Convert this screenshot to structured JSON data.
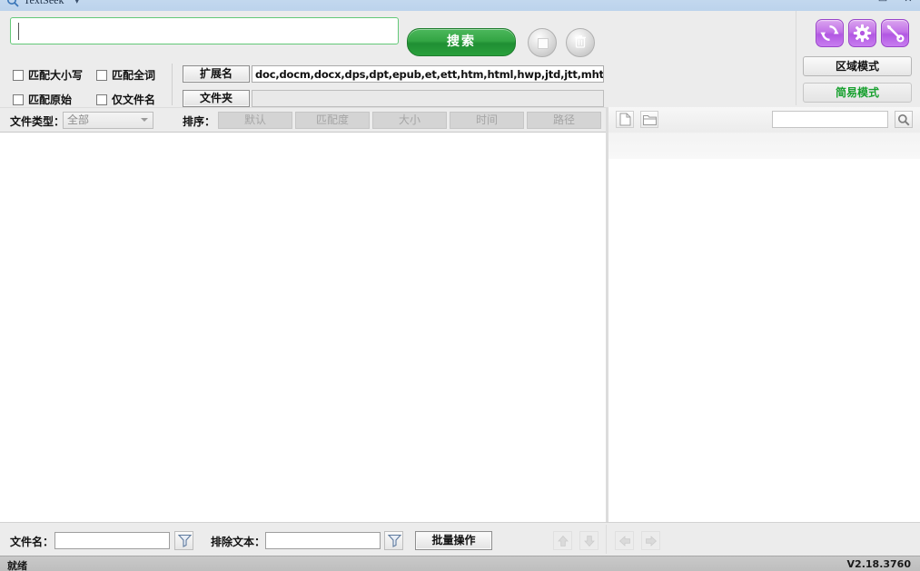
{
  "window": {
    "app_title": "TextSeek",
    "title_caret": "▾",
    "minimize": "—",
    "maximize": "▭",
    "close": "✕"
  },
  "search": {
    "query_value": "",
    "query_placeholder": "",
    "search_button": "搜索",
    "stop_button_name": "stop",
    "trash_button_glyph": "🗑"
  },
  "options": {
    "match_case": "匹配大小写",
    "match_whole_word": "匹配全词",
    "match_original": "匹配原始",
    "filename_only": "仅文件名"
  },
  "filters": {
    "extension_button": "扩展名",
    "extension_value": "doc,docm,docx,dps,dpt,epub,et,ett,htm,html,hwp,jtd,jtt,mht,mhtml,odp,ods,odt,o",
    "folder_button": "文件夹",
    "folder_value": ""
  },
  "modes": {
    "refresh_icon": "refresh-icon",
    "settings_icon": "gear-icon",
    "tools_icon": "wrench-icon",
    "area_mode": "区域模式",
    "simple_mode": "简易模式",
    "simple_mode_color": "#17a02e"
  },
  "sortbar": {
    "filetype_label": "文件类型：",
    "filetype_value": "全部",
    "sort_label": "排序：",
    "sort_buttons": [
      "默认",
      "匹配度",
      "大小",
      "时间",
      "路径"
    ]
  },
  "preview": {
    "doc_icon": "document-icon",
    "folder_icon": "folder-icon",
    "search_value": "",
    "search_placeholder": "",
    "go_icon": "magnifier-icon"
  },
  "bottom": {
    "filename_label": "文件名：",
    "filename_value": "",
    "exclude_label": "排除文本：",
    "exclude_value": "",
    "batch_button": "批量操作",
    "nav_up": "▲",
    "nav_down": "▼",
    "nav_left": "◀",
    "nav_right": "▶"
  },
  "status": {
    "message": "就绪",
    "version": "V2.18.3760"
  }
}
